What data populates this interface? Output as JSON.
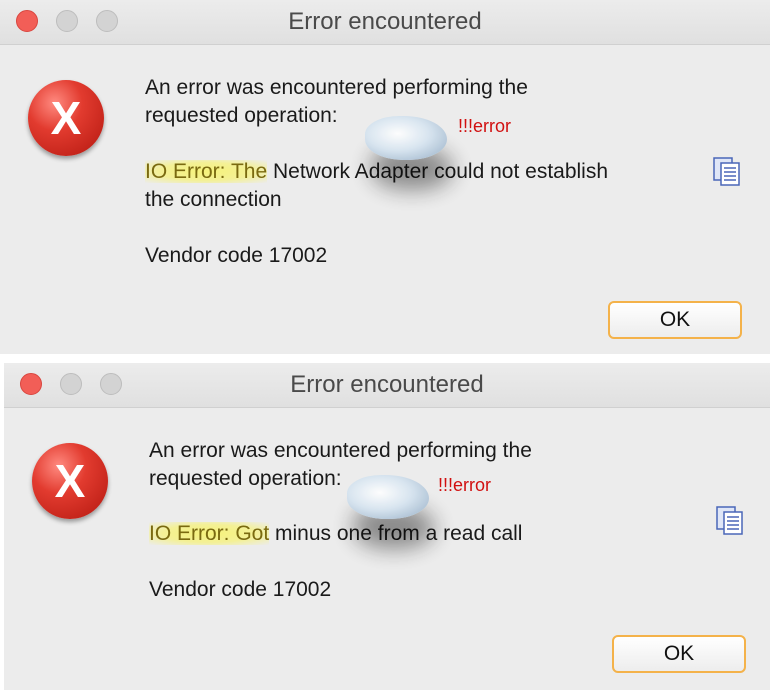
{
  "dialogs": [
    {
      "title": "Error encountered",
      "message_line1": "An error was encountered performing the",
      "message_line2": "requested operation:",
      "error_highlight": "IO Error: The",
      "error_rest": " Network Adapter could not establish",
      "error_line2": "the connection",
      "vendor_code": "Vendor code 17002",
      "annotation_tag": "!!!error",
      "ok_label": "OK"
    },
    {
      "title": "Error encountered",
      "message_line1": "An error was encountered performing the",
      "message_line2": "requested operation:",
      "error_highlight": "IO Error: Got",
      "error_rest": " minus one from a read call",
      "vendor_code": "Vendor code 17002",
      "annotation_tag": "!!!error",
      "ok_label": "OK"
    }
  ],
  "icons": {
    "error_glyph": "X",
    "error_color": "#e23b2f",
    "accent_button_border": "#f4b24a"
  }
}
